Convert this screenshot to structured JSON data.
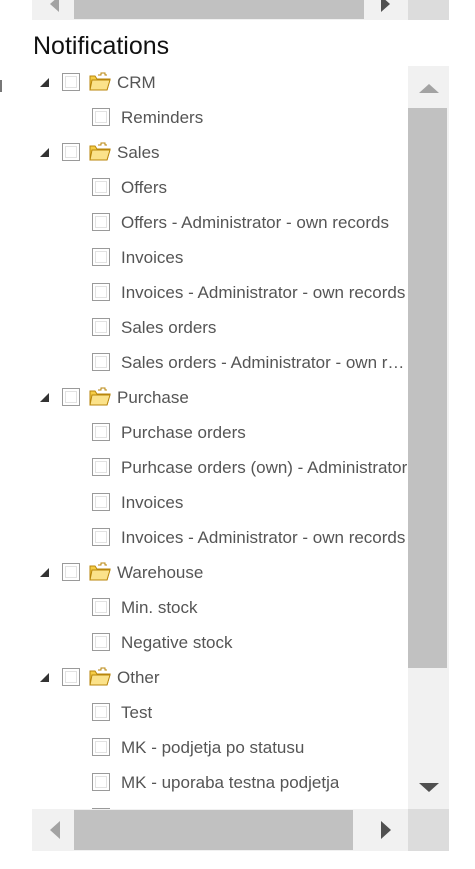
{
  "title": "Notifications",
  "tree": [
    {
      "label": "CRM",
      "type": "group"
    },
    {
      "label": "Reminders",
      "type": "leaf"
    },
    {
      "label": "Sales",
      "type": "group"
    },
    {
      "label": "Offers",
      "type": "leaf"
    },
    {
      "label": "Offers - Administrator - own records",
      "type": "leaf"
    },
    {
      "label": "Invoices",
      "type": "leaf"
    },
    {
      "label": "Invoices - Administrator - own records",
      "type": "leaf"
    },
    {
      "label": "Sales orders",
      "type": "leaf"
    },
    {
      "label": "Sales orders - Administrator - own records",
      "type": "leaf"
    },
    {
      "label": "Purchase",
      "type": "group"
    },
    {
      "label": "Purchase orders",
      "type": "leaf"
    },
    {
      "label": "Purhcase orders (own) - Administrator",
      "type": "leaf"
    },
    {
      "label": "Invoices",
      "type": "leaf"
    },
    {
      "label": "Invoices - Administrator - own records",
      "type": "leaf"
    },
    {
      "label": "Warehouse",
      "type": "group"
    },
    {
      "label": "Min. stock",
      "type": "leaf"
    },
    {
      "label": "Negative stock",
      "type": "leaf"
    },
    {
      "label": "Other",
      "type": "group"
    },
    {
      "label": "Test",
      "type": "leaf"
    },
    {
      "label": "MK - podjetja po statusu",
      "type": "leaf"
    },
    {
      "label": "MK - uporaba testna podjetja",
      "type": "leaf"
    },
    {
      "label": "",
      "type": "leaf"
    }
  ],
  "colors": {
    "text": "#555555",
    "title": "#111111",
    "scrollbar_track": "#f1f1f1",
    "scrollbar_thumb": "#c1c1c1",
    "folder": "#f5cc45"
  },
  "icons": {
    "expander": "expanded-triangle-icon",
    "folder": "folder-icon",
    "checkbox": "checkbox-icon"
  }
}
